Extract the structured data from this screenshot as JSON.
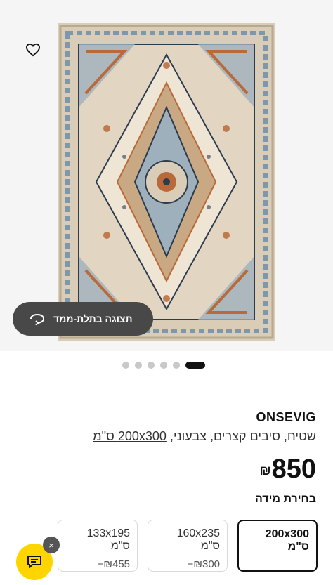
{
  "gallery": {
    "view_3d_label": "תצוגה בתלת-ממד",
    "dots_total": 6,
    "active_dot_index": 5
  },
  "product": {
    "name": "ONSEVIG",
    "description_prefix": "שטיח, סיבים קצרים, צבעוני,",
    "description_size": "200x300 ס\"מ",
    "price_currency": "₪",
    "price_amount": "850"
  },
  "size_section": {
    "heading": "בחירת מידה",
    "options": [
      {
        "size": "200x300 ס\"מ",
        "diff": "",
        "selected": true
      },
      {
        "size": "160x235 ס\"מ",
        "diff": "₪300−",
        "selected": false
      },
      {
        "size": "133x195 ס\"מ",
        "diff": "₪455−",
        "selected": false
      }
    ]
  },
  "chat": {
    "close_label": "×"
  },
  "colors": {
    "accent_yellow": "#ffd500",
    "pill_bg": "#484848",
    "rug_base": "#d9cdb8",
    "rug_blue": "#7d98ad",
    "rug_rust": "#b86a3a",
    "rug_cream": "#eee5d4",
    "rug_navy": "#2d3b4e"
  },
  "icons": {
    "wishlist": "heart-icon",
    "view_3d": "rotate-3d-icon",
    "chat": "chat-bubble-icon",
    "close": "close-icon"
  }
}
